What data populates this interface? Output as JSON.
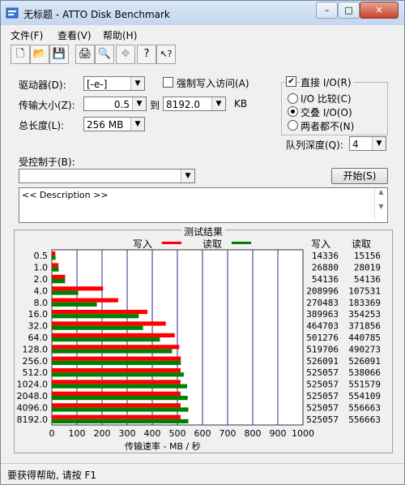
{
  "window": {
    "title": "无标题 - ATTO Disk Benchmark"
  },
  "title_buttons": {
    "minimize": "–",
    "maximize": "□",
    "close": "✕"
  },
  "menu": [
    "文件(F)",
    "查看(V)",
    "帮助(H)"
  ],
  "toolbar_icons": [
    "new-file-icon",
    "open-folder-icon",
    "save-icon",
    "print-icon",
    "print-preview-icon",
    "move-icon",
    "help-icon",
    "context-help-icon"
  ],
  "toolbar_glyphs": [
    "🗋",
    "📂",
    "💾",
    "🖨",
    "🔍",
    "✥",
    "?",
    "↖?"
  ],
  "settings": {
    "drive_label": "驱动器(D):",
    "drive_value": "[-e-]",
    "transfer_label": "传输大小(Z):",
    "transfer_from": "0.5",
    "to_label": "到",
    "transfer_to": "8192.0",
    "unit": "KB",
    "length_label": "总长度(L):",
    "length_value": "256 MB",
    "force_write_label": "强制写入访问(A)",
    "direct_io_label": "直接 I/O(R)",
    "io_compare_label": "I/O 比较(C)",
    "overlapped_label": "交叠 I/O(O)",
    "neither_label": "两者都不(N)",
    "queue_label": "队列深度(Q):",
    "queue_value": "4",
    "controlled_label": "受控制于(B):",
    "controlled_value": "",
    "start_button": "开始(S)",
    "description": "<< Description >>"
  },
  "chart_data": {
    "type": "bar",
    "title": "测试结果",
    "legend": [
      {
        "name": "写入",
        "color": "#ff0000"
      },
      {
        "name": "读取",
        "color": "#008000"
      }
    ],
    "categories": [
      "0.5",
      "1.0",
      "2.0",
      "4.0",
      "8.0",
      "16.0",
      "32.0",
      "64.0",
      "128.0",
      "256.0",
      "512.0",
      "1024.0",
      "2048.0",
      "4096.0",
      "8192.0"
    ],
    "series": [
      {
        "name": "写入",
        "values": [
          14336,
          26880,
          54136,
          208996,
          270483,
          389963,
          464703,
          501276,
          519706,
          526091,
          525057,
          525057,
          525057,
          525057,
          525057
        ]
      },
      {
        "name": "读取",
        "values": [
          15156,
          28019,
          54136,
          107531,
          183369,
          354253,
          371856,
          440785,
          490273,
          526091,
          538066,
          551579,
          554109,
          556663,
          556663
        ]
      }
    ],
    "xlim": [
      0,
      1000
    ],
    "xticks": [
      "0",
      "100",
      "200",
      "300",
      "400",
      "500",
      "600",
      "700",
      "800",
      "900",
      "1000"
    ],
    "xlabel": "传输速率 - MB / 秒",
    "col_write": "写入",
    "col_read": "读取"
  },
  "status": "要获得帮助, 请按 F1"
}
